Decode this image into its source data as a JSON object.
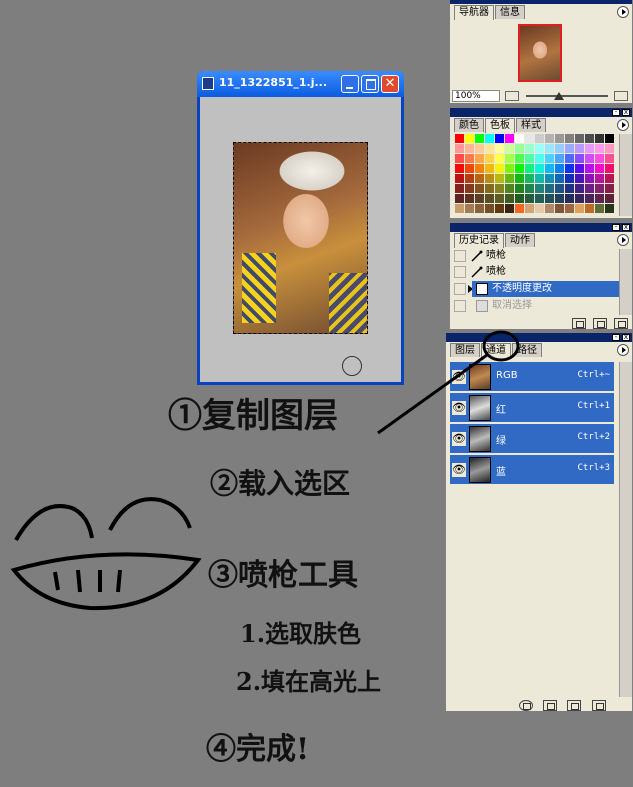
{
  "document_window": {
    "title": "11_1322851_1.j..."
  },
  "navigator_panel": {
    "tabs": [
      "导航器",
      "信息"
    ],
    "zoom": "100%"
  },
  "swatches_panel": {
    "tabs": [
      "颜色",
      "色板",
      "样式"
    ],
    "active_tab": "色板",
    "colors": [
      "#ff0000",
      "#ffff00",
      "#00ff00",
      "#00ffff",
      "#0000ff",
      "#ff00ff",
      "#ffffff",
      "#e6e6e6",
      "#cccccc",
      "#b3b3b3",
      "#999999",
      "#808080",
      "#666666",
      "#4d4d4d",
      "#333333",
      "#000000"
    ]
  },
  "history_panel": {
    "tabs": [
      "历史记录",
      "动作"
    ],
    "items": [
      {
        "label": "喷枪",
        "icon": "airbrush-icon",
        "state": "normal"
      },
      {
        "label": "喷枪",
        "icon": "airbrush-icon",
        "state": "normal"
      },
      {
        "label": "不透明度更改",
        "icon": "document-icon",
        "state": "selected"
      },
      {
        "label": "取消选择",
        "icon": "document-icon",
        "state": "undone"
      }
    ]
  },
  "channels_panel": {
    "tabs": [
      "图层",
      "通道",
      "路径"
    ],
    "active_tab": "通道",
    "channels": [
      {
        "name": "RGB",
        "shortcut": "Ctrl+~"
      },
      {
        "name": "红",
        "shortcut": "Ctrl+1"
      },
      {
        "name": "绿",
        "shortcut": "Ctrl+2"
      },
      {
        "name": "蓝",
        "shortcut": "Ctrl+3"
      }
    ]
  },
  "annotations": {
    "step1": "①复制图层",
    "step2": "②载入选区",
    "step3": "③喷枪工具",
    "sub1": "1.选取肤色",
    "sub2": "2.填在高光上",
    "step4": "④完成!"
  }
}
